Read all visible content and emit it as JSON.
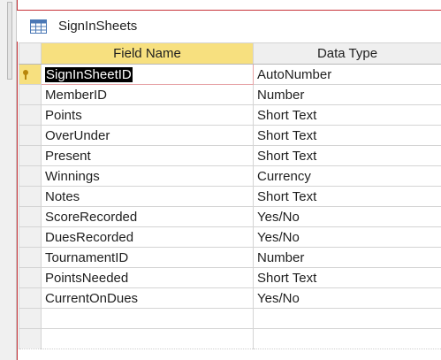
{
  "tab": {
    "title": "SignInSheets",
    "icon": "table-icon"
  },
  "grid": {
    "headers": {
      "field_name": "Field Name",
      "data_type": "Data Type"
    },
    "rows": [
      {
        "field": "SignInSheetID",
        "type": "AutoNumber"
      },
      {
        "field": "MemberID",
        "type": "Number"
      },
      {
        "field": "Points",
        "type": "Short Text"
      },
      {
        "field": "OverUnder",
        "type": "Short Text"
      },
      {
        "field": "Present",
        "type": "Short Text"
      },
      {
        "field": "Winnings",
        "type": "Currency"
      },
      {
        "field": "Notes",
        "type": "Short Text"
      },
      {
        "field": "ScoreRecorded",
        "type": "Yes/No"
      },
      {
        "field": "DuesRecorded",
        "type": "Yes/No"
      },
      {
        "field": "TournamentID",
        "type": "Number"
      },
      {
        "field": "PointsNeeded",
        "type": "Short Text"
      },
      {
        "field": "CurrentOnDues",
        "type": "Yes/No"
      }
    ]
  },
  "colors": {
    "accent": "#c8333a",
    "selected_header": "#f7e07f",
    "active_cell": "#000000"
  }
}
